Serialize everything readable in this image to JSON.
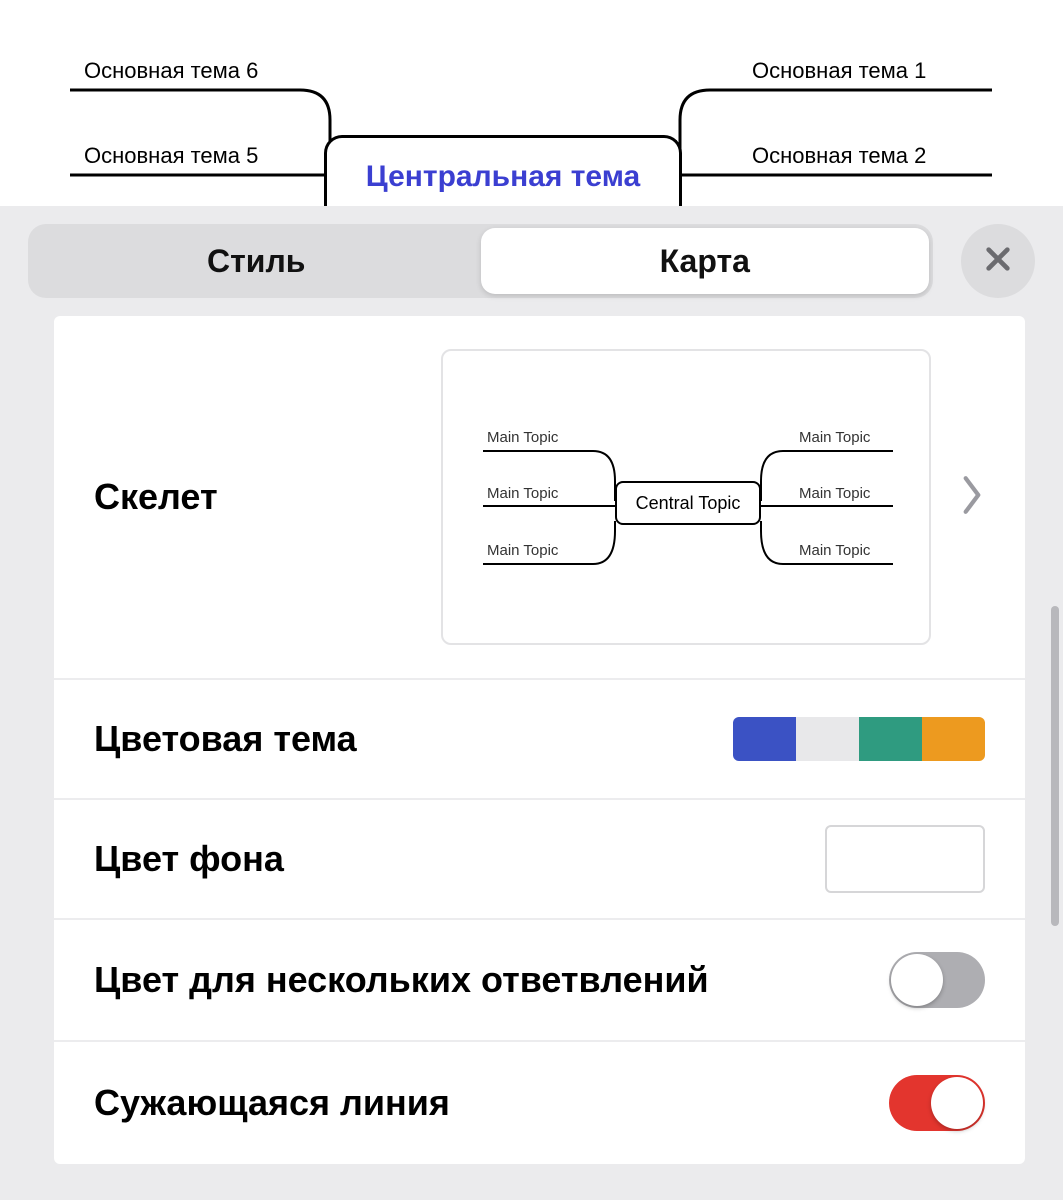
{
  "canvas": {
    "central": "Центральная тема",
    "branches": {
      "left_top": "Основная тема 6",
      "left_mid": "Основная тема 5",
      "right_top": "Основная тема 1",
      "right_mid": "Основная тема 2"
    }
  },
  "tabs": {
    "style": "Стиль",
    "map": "Карта",
    "active": "map"
  },
  "close_icon": "close-icon",
  "skeleton": {
    "label": "Скелет",
    "preview_central": "Central Topic",
    "preview_branch": "Main Topic"
  },
  "color_theme": {
    "label": "Цветовая тема",
    "colors": [
      "#3b52c4",
      "#e8e8ea",
      "#2f9b80",
      "#ed9a1f"
    ]
  },
  "bg_color": {
    "label": "Цвет фона",
    "value": "#ffffff"
  },
  "multi_branch_color": {
    "label": "Цвет для нескольких ответвлений",
    "value": false
  },
  "tapered_line": {
    "label": "Сужающаяся линия",
    "value": true
  }
}
